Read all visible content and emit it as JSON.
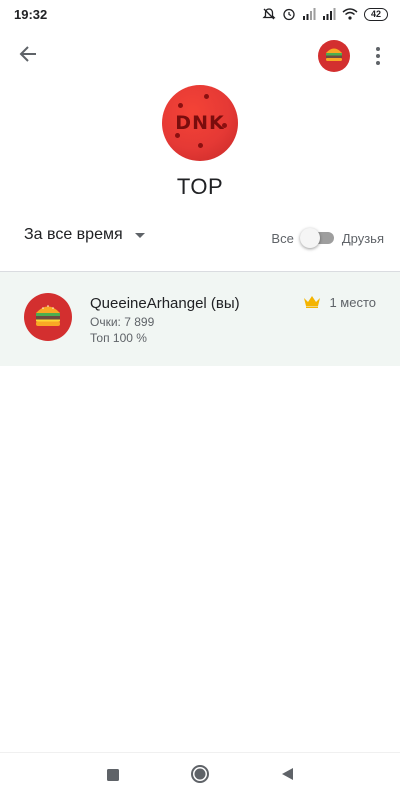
{
  "status_bar": {
    "time": "19:32",
    "battery": "42",
    "icons": [
      "mute-bell-icon",
      "alarm-icon",
      "signal-icon",
      "signal-icon",
      "wifi-icon",
      "battery-icon"
    ]
  },
  "header": {
    "back_icon": "arrow-back-icon",
    "menu_icon": "more-vert-icon"
  },
  "game": {
    "logo_text": "DNK",
    "title": "TOP"
  },
  "filters": {
    "time_range": "За все время",
    "toggle_left": "Все",
    "toggle_right": "Друзья",
    "friends_only": false
  },
  "leaderboard": [
    {
      "name": "QueeineArhangel (вы)",
      "score": "Очки: 7 899",
      "percentile": "Топ 100 %",
      "rank": "1 место",
      "rank_icon": "crown-icon"
    }
  ],
  "colors": {
    "accent_red": "#d32f2f",
    "row_highlight": "#f1f6f3",
    "crown": "#f4b400"
  },
  "nav": {
    "icons": [
      "recents-square-icon",
      "home-circle-icon",
      "back-triangle-icon"
    ]
  }
}
